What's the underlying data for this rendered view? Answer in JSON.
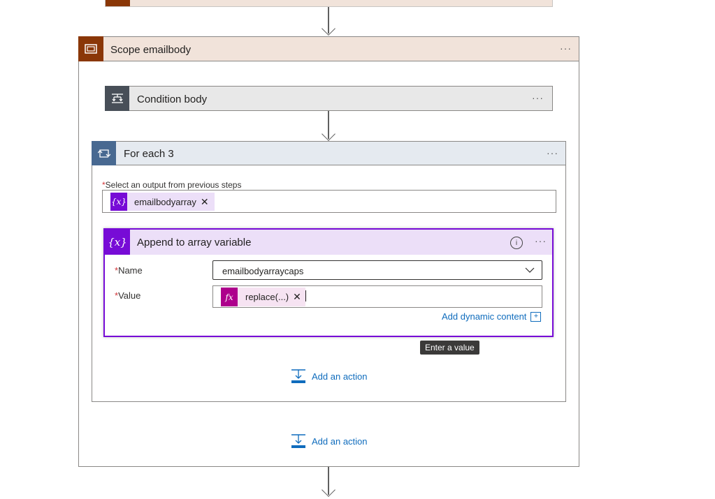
{
  "scope": {
    "title": "Scope emailbody",
    "menu": "···"
  },
  "condition": {
    "title": "Condition body",
    "menu": "···"
  },
  "foreach": {
    "title": "For each 3",
    "menu": "···",
    "select_label": "Select an output from previous steps",
    "token_label": "emailbodyarray",
    "token_icon": "{x}"
  },
  "append": {
    "title": "Append to array variable",
    "icon": "{x}",
    "info": "i",
    "menu": "···",
    "name_label": "Name",
    "name_value": "emailbodyarraycaps",
    "value_label": "Value",
    "value_token": "replace(...)",
    "value_token_icon": "fx",
    "add_dynamic": "Add dynamic content",
    "required_mark": "*"
  },
  "tooltip": "Enter a value",
  "inner_add_action": "Add an action",
  "outer_add_action": "Add an action",
  "colors": {
    "scope_accent": "#8a3707",
    "scope_header": "#f1e3da",
    "condition_icon": "#484f58",
    "foreach_accent": "#486991",
    "foreach_header": "#e5eaf0",
    "variable_accent": "#770bd6",
    "variable_header": "#ecdff8",
    "fx_accent": "#ad008c",
    "link": "#0f6cbd"
  }
}
